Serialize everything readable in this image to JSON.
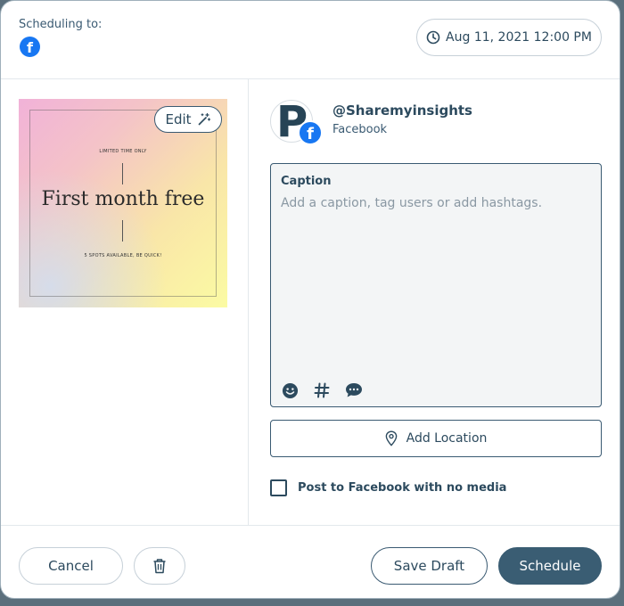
{
  "header": {
    "scheduling_label": "Scheduling to:",
    "network_icon": "facebook-icon",
    "datetime": "Aug 11, 2021 12:00 PM"
  },
  "media": {
    "edit_label": "Edit",
    "image": {
      "top_text": "LIMITED TIME ONLY",
      "title": "First month free",
      "bottom_text": "5 SPOTS AVAILABLE, BE QUICK!"
    }
  },
  "account": {
    "avatar_letter": "P",
    "name": "@Sharemyinsights",
    "network": "Facebook"
  },
  "caption": {
    "label": "Caption",
    "placeholder": "Add a caption, tag users or add hashtags.",
    "tools": [
      "emoji-icon",
      "hashtag-icon",
      "speech-bubble-icon"
    ]
  },
  "location": {
    "label": "Add Location"
  },
  "options": {
    "no_media_label": "Post to Facebook with no media",
    "no_media_checked": false
  },
  "footer": {
    "cancel_label": "Cancel",
    "save_draft_label": "Save Draft",
    "schedule_label": "Schedule"
  },
  "colors": {
    "primary": "#3a5d73",
    "text": "#2c4a5e",
    "facebook": "#1877f2"
  }
}
